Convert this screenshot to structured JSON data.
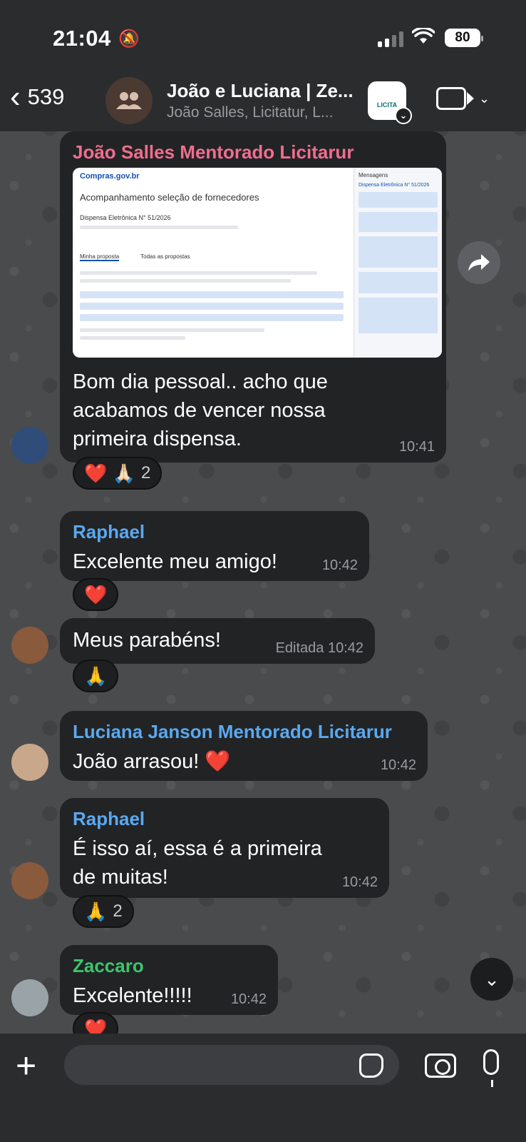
{
  "status_bar": {
    "time": "21:04",
    "battery": "80"
  },
  "header": {
    "back_count": "539",
    "title": "João e Luciana | Ze...",
    "subtitle": "João Salles, Licitatur, L...",
    "app_icon_label": "LICITA"
  },
  "messages": [
    {
      "sender": "João Salles Mentorado Licitarur",
      "sender_color": "#ef6e8f",
      "screenshot": {
        "logo": "Compras.gov.br",
        "title": "Acompanhamento seleção de fornecedores",
        "subtitle": "Dispensa Eletrônica N° 51/2026",
        "tab1": "Minha proposta",
        "tab2": "Todas as propostas",
        "panel_title": "Mensagens",
        "panel_sub": "Dispensa Eletrônica N° 51/2026"
      },
      "text": "Bom dia pessoal.. acho que acabamos de vencer nossa primeira dispensa.",
      "time": "10:41",
      "reaction": {
        "emojis": "❤️ 🙏🏻",
        "count": "2"
      }
    },
    {
      "sender": "Raphael",
      "sender_color": "#5aa9f0",
      "text": "Excelente meu amigo!",
      "time": "10:42",
      "reaction": {
        "emojis": "❤️",
        "count": ""
      }
    },
    {
      "sender": "",
      "text": "Meus parabéns!",
      "time": "Editada 10:42",
      "reaction": {
        "emojis": "🙏",
        "count": ""
      }
    },
    {
      "sender": "Luciana Janson Mentorado Licitarur",
      "sender_color": "#5aa9f0",
      "text": "João arrasou! ❤️",
      "time": "10:42"
    },
    {
      "sender": "Raphael",
      "sender_color": "#5aa9f0",
      "text": "É isso aí, essa é a primeira de muitas!",
      "time": "10:42",
      "reaction": {
        "emojis": "🙏",
        "count": "2"
      }
    },
    {
      "sender": "Zaccaro",
      "sender_color": "#3fc46b",
      "text": "Excelente!!!!!",
      "time": "10:42",
      "reaction": {
        "emojis": "❤️",
        "count": ""
      }
    }
  ],
  "composer": {
    "placeholder": ""
  }
}
